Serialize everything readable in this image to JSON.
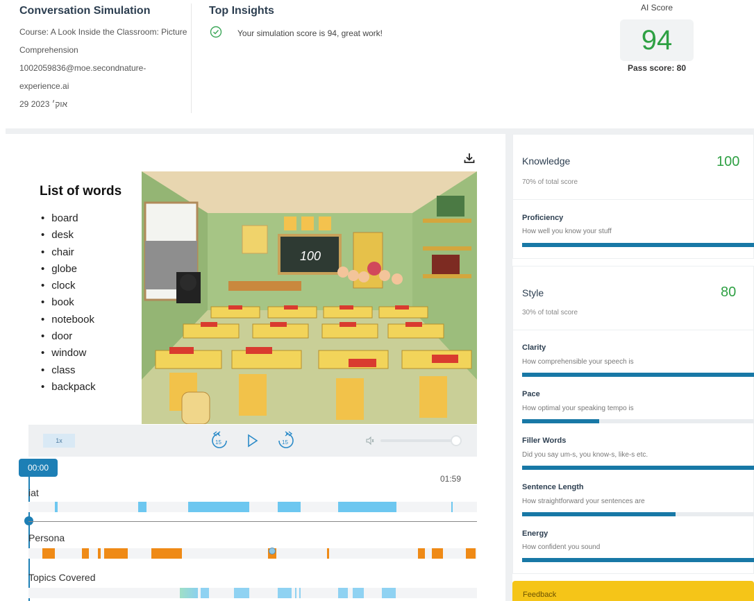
{
  "header": {
    "title": "Conversation Simulation",
    "course": "Course: A Look Inside the Classroom: Picture",
    "course_cont": "Comprehension",
    "email1": "1002059836@moe.secondnature-",
    "email2": "experience.ai",
    "date": "29 אוק׳ 2023",
    "insights_title": "Top Insights",
    "insight": "Your simulation score is 94, great work!",
    "ai_label": "AI Score",
    "score": "94",
    "pass": "Pass score: 80"
  },
  "slide": {
    "title": "List of words",
    "words": [
      "board",
      "desk",
      "chair",
      "globe",
      "clock",
      "book",
      "notebook",
      "door",
      "window",
      "class",
      "backpack"
    ],
    "board_text": "100"
  },
  "player": {
    "speed": "1x",
    "time_current": "00:00",
    "time_total": "01:59"
  },
  "tracks": {
    "t1": "iat",
    "t2": "Persona",
    "t3": "Topics Covered"
  },
  "knowledge": {
    "title": "Knowledge",
    "score": "100",
    "sub": "70% of total score",
    "metrics": [
      {
        "title": "Proficiency",
        "desc": "How well you know your stuff",
        "value": 1.0
      }
    ]
  },
  "style": {
    "title": "Style",
    "score": "80",
    "sub": "30% of total score",
    "metrics": [
      {
        "title": "Clarity",
        "desc": "How comprehensible your speech is",
        "value": 1.0
      },
      {
        "title": "Pace",
        "desc": "How optimal your speaking tempo is",
        "value": 0.33
      },
      {
        "title": "Filler Words",
        "desc": "Did you say um-s, you know-s, like-s etc.",
        "value": 1.0
      },
      {
        "title": "Sentence Length",
        "desc": "How straightforward your sentences are",
        "value": 0.66
      },
      {
        "title": "Energy",
        "desc": "How confident you sound",
        "value": 1.0
      }
    ]
  },
  "feedback": {
    "label": "Feedback"
  },
  "colors": {
    "score_green": "#2ea043",
    "bar_blue": "#1878a6",
    "feedback_yellow": "#f5c518"
  }
}
